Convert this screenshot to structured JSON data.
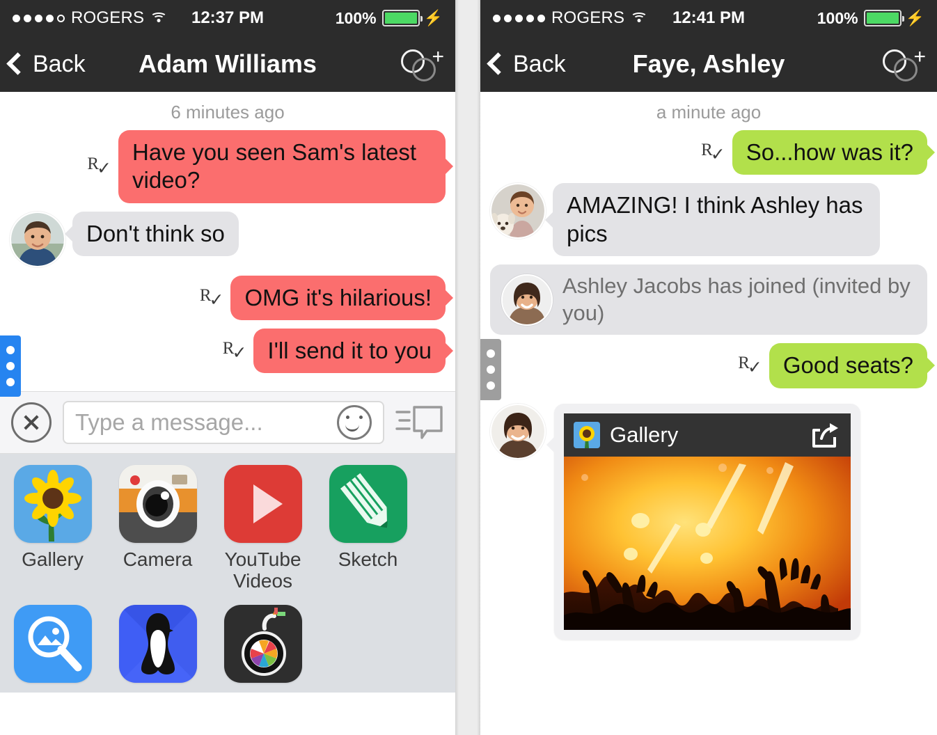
{
  "panels": [
    {
      "id": "left",
      "status": {
        "signal_filled": 4,
        "signal_total": 5,
        "carrier": "ROGERS",
        "time": "12:37 PM",
        "battery_percent": "100%",
        "battery_level": 100,
        "charging": true,
        "wifi_icon": "wifi-icon",
        "bolt_icon": "lightning-bolt-icon"
      },
      "nav": {
        "back_label": "Back",
        "back_icon": "chevron-left-icon",
        "title": "Adam Williams",
        "add_people_icon": "add-people-icon"
      },
      "conversation": {
        "timestamp": "6 minutes ago",
        "messages": [
          {
            "dir": "out",
            "text": "Have you seen Sam's latest video?",
            "receipt": "R",
            "receipt_check": "✓",
            "color": "#fb6e6e"
          },
          {
            "dir": "in",
            "text": "Don't think so",
            "avatar": "avatar-man",
            "color": "#e3e3e6"
          },
          {
            "dir": "out",
            "text": "OMG it's hilarious!",
            "receipt": "R",
            "receipt_check": "✓",
            "color": "#fb6e6e"
          },
          {
            "dir": "out",
            "text": "I'll send it to you",
            "receipt": "R",
            "receipt_check": "✓",
            "color": "#fb6e6e"
          }
        ],
        "handle": {
          "name": "tab-handle",
          "color": "#2684f0",
          "dots": 3
        }
      },
      "composer": {
        "close_icon": "close-circle-icon",
        "placeholder": "Type a message...",
        "value": "",
        "emoji_icon": "smiley-icon",
        "quick_message_icon": "quick-message-icon"
      },
      "drawer": {
        "apps": [
          {
            "label": "Gallery",
            "icon": "gallery-icon"
          },
          {
            "label": "Camera",
            "icon": "camera-icon"
          },
          {
            "label": "YouTube Videos",
            "icon": "youtube-icon"
          },
          {
            "label": "Sketch",
            "icon": "sketch-icon"
          },
          {
            "label": "",
            "icon": "photo-search-icon"
          },
          {
            "label": "",
            "icon": "penguin-icon"
          },
          {
            "label": "",
            "icon": "bomb-camera-icon"
          }
        ]
      }
    },
    {
      "id": "right",
      "status": {
        "signal_filled": 5,
        "signal_total": 5,
        "carrier": "ROGERS",
        "time": "12:41 PM",
        "battery_percent": "100%",
        "battery_level": 100,
        "charging": true,
        "wifi_icon": "wifi-icon",
        "bolt_icon": "lightning-bolt-icon"
      },
      "nav": {
        "back_label": "Back",
        "back_icon": "chevron-left-icon",
        "title": "Faye, Ashley",
        "add_people_icon": "add-people-icon"
      },
      "conversation": {
        "timestamp": "a minute ago",
        "messages": [
          {
            "dir": "out",
            "text": "So...how was it?",
            "receipt": "R",
            "receipt_check": "✓",
            "color": "#b2e04b"
          },
          {
            "dir": "in",
            "text": "AMAZING! I think Ashley has pics",
            "avatar": "avatar-woman-dog",
            "color": "#e3e3e6"
          },
          {
            "dir": "system",
            "text": "Ashley Jacobs has joined (invited by you)",
            "avatar": "avatar-woman-dark",
            "color": "#e3e3e6"
          },
          {
            "dir": "out",
            "text": "Good seats?",
            "receipt": "R",
            "receipt_check": "✓",
            "color": "#b2e04b"
          }
        ],
        "handle": {
          "name": "tab-handle",
          "color": "#9e9e9e",
          "dots": 3
        },
        "attachment": {
          "avatar": "avatar-woman-smiling",
          "app_name": "Gallery",
          "app_icon": "gallery-icon",
          "share_icon": "share-icon",
          "image_alt": "concert-crowd-photo"
        }
      }
    }
  ],
  "colors": {
    "navbar": "#2c2c2c",
    "outgoing_red": "#fb6e6e",
    "outgoing_green": "#b2e04b",
    "incoming_gray": "#e3e3e6",
    "battery_green": "#4cd964",
    "handle_blue": "#2684f0",
    "handle_gray": "#9e9e9e",
    "drawer_bg": "#dcdfe3"
  }
}
